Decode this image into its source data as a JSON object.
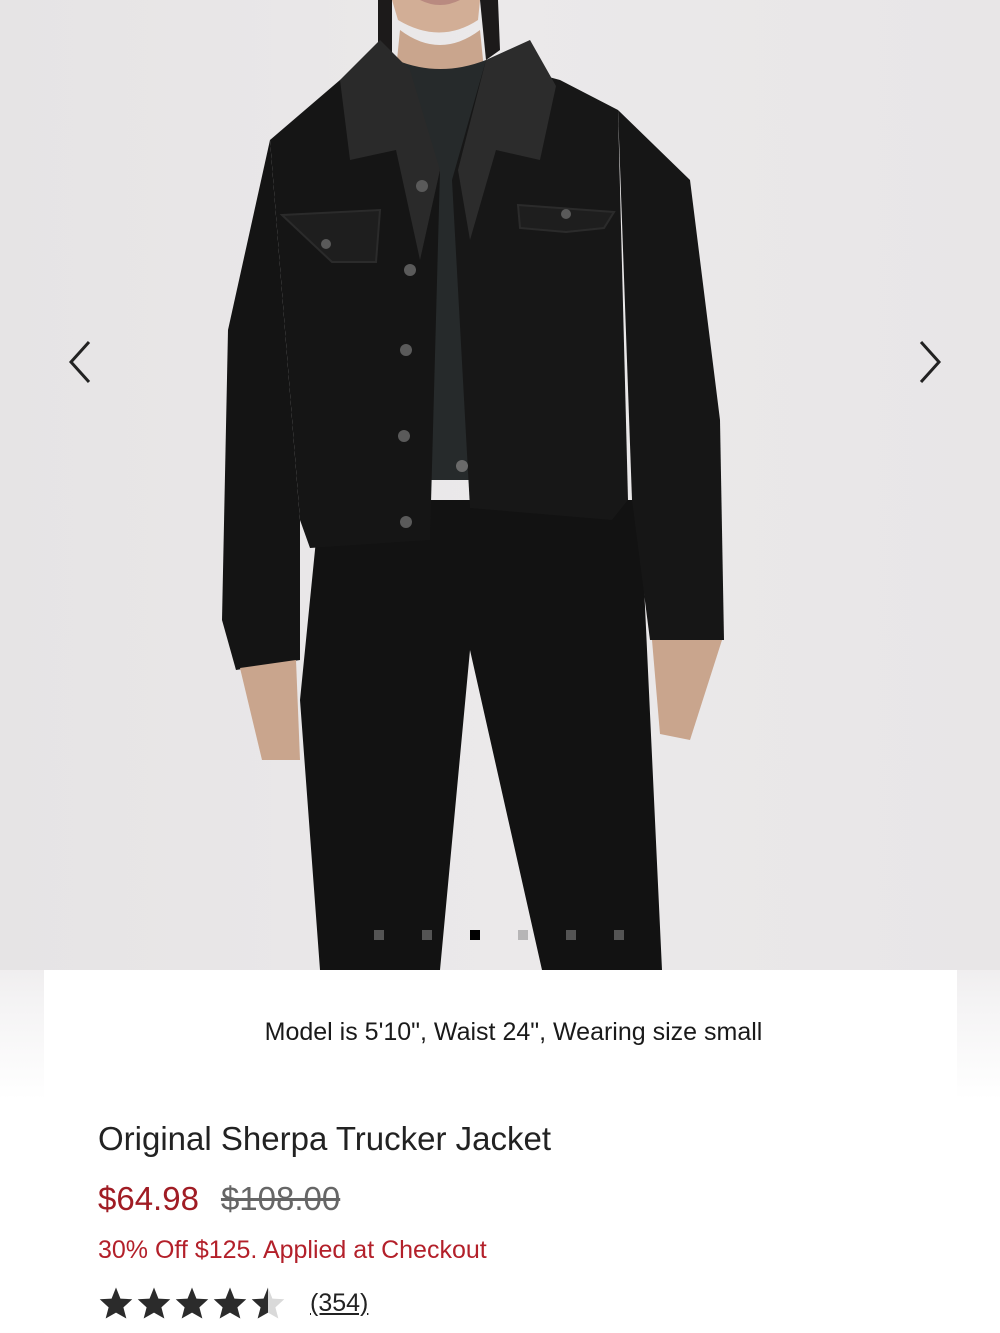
{
  "carousel": {
    "prev_icon": "chevron-left-icon",
    "next_icon": "chevron-right-icon",
    "dot_count": 6,
    "active_index": 2
  },
  "product": {
    "model_info": "Model is 5'10\", Waist 24\", Wearing size small",
    "title": "Original Sherpa Trucker Jacket",
    "sale_price": "$64.98",
    "original_price": "$108.00",
    "promo": "30% Off $125. Applied at Checkout",
    "rating": 4.5,
    "review_count": "(354)"
  },
  "colors": {
    "sale": "#a01c24",
    "promo": "#b3202a"
  }
}
